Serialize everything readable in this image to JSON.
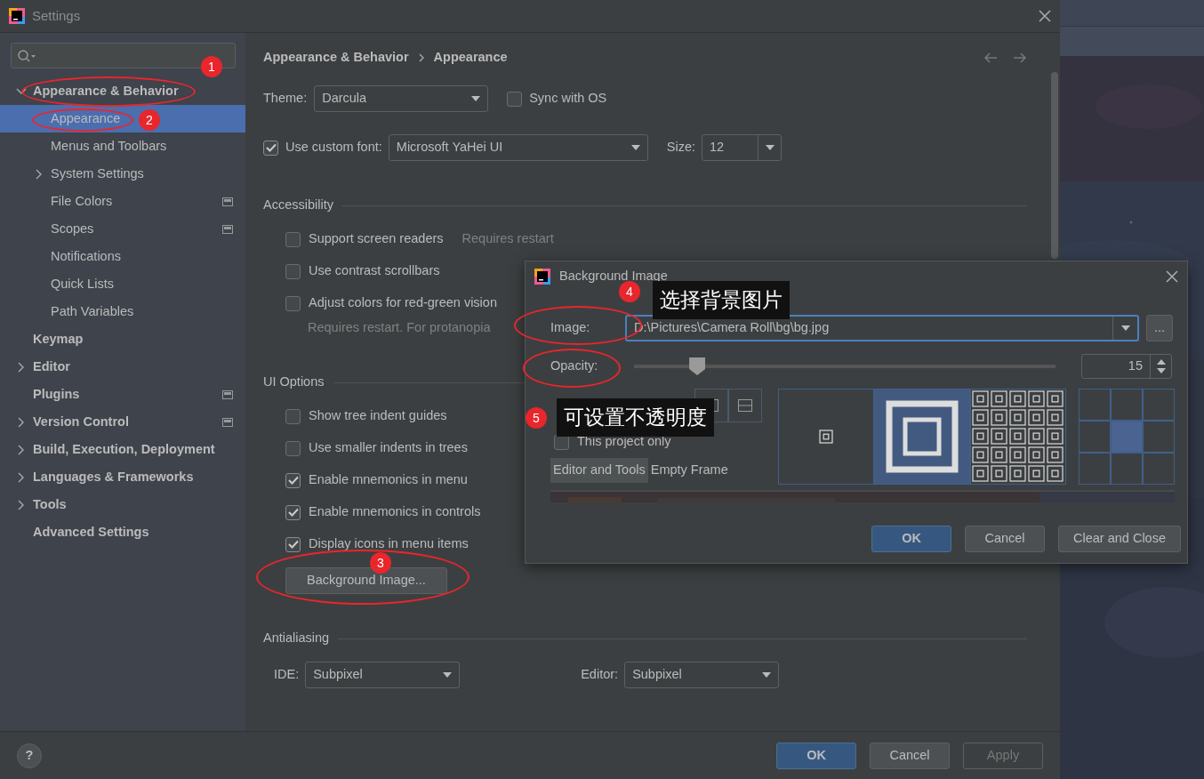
{
  "window": {
    "title": "Settings"
  },
  "sidebar": {
    "items": [
      {
        "label": "Appearance & Behavior",
        "expanded": true,
        "selected": false,
        "scope_icon": false,
        "children": [
          {
            "label": "Appearance",
            "selected": true,
            "scope_icon": false
          },
          {
            "label": "Menus and Toolbars",
            "selected": false,
            "scope_icon": false
          },
          {
            "label": "System Settings",
            "expanded": false,
            "selected": false,
            "scope_icon": false
          },
          {
            "label": "File Colors",
            "selected": false,
            "scope_icon": true
          },
          {
            "label": "Scopes",
            "selected": false,
            "scope_icon": true
          },
          {
            "label": "Notifications",
            "selected": false,
            "scope_icon": false
          },
          {
            "label": "Quick Lists",
            "selected": false,
            "scope_icon": false
          },
          {
            "label": "Path Variables",
            "selected": false,
            "scope_icon": false
          }
        ]
      },
      {
        "label": "Keymap",
        "selected": false,
        "scope_icon": false
      },
      {
        "label": "Editor",
        "expanded": false,
        "selected": false,
        "scope_icon": false
      },
      {
        "label": "Plugins",
        "selected": false,
        "scope_icon": true
      },
      {
        "label": "Version Control",
        "expanded": false,
        "selected": false,
        "scope_icon": true
      },
      {
        "label": "Build, Execution, Deployment",
        "expanded": false,
        "selected": false,
        "scope_icon": false
      },
      {
        "label": "Languages & Frameworks",
        "expanded": false,
        "selected": false,
        "scope_icon": false
      },
      {
        "label": "Tools",
        "expanded": false,
        "selected": false,
        "scope_icon": false
      },
      {
        "label": "Advanced Settings",
        "selected": false,
        "scope_icon": false
      }
    ]
  },
  "breadcrumb": [
    "Appearance & Behavior",
    "Appearance"
  ],
  "theme": {
    "label": "Theme:",
    "value": "Darcula",
    "sync": {
      "label": "Sync with OS",
      "checked": false
    }
  },
  "font": {
    "label": "Use custom font:",
    "checked": true,
    "value": "Microsoft YaHei UI",
    "size_label": "Size:",
    "size": "12"
  },
  "sections": [
    {
      "title": "Accessibility",
      "options": [
        {
          "label": "Support screen readers",
          "checked": false,
          "note": "Requires restart"
        },
        {
          "label": "Use contrast scrollbars",
          "checked": false
        },
        {
          "label": "Adjust colors for red-green vision",
          "checked": false,
          "hint": "Requires restart. For protanopia"
        }
      ]
    },
    {
      "title": "UI Options",
      "options": [
        {
          "label": "Show tree indent guides",
          "checked": false
        },
        {
          "label": "Use smaller indents in trees",
          "checked": false
        },
        {
          "label": "Enable mnemonics in menu",
          "checked": true
        },
        {
          "label": "Enable mnemonics in controls",
          "checked": true
        },
        {
          "label": "Display icons in menu items",
          "checked": true
        }
      ],
      "button": "Background Image..."
    },
    {
      "title": "Antialiasing",
      "fields": [
        {
          "label": "IDE:",
          "value": "Subpixel"
        },
        {
          "label": "Editor:",
          "value": "Subpixel"
        }
      ]
    }
  ],
  "footer": {
    "help": "?",
    "buttons": [
      {
        "label": "OK",
        "kind": "primary",
        "disabled": false
      },
      {
        "label": "Cancel",
        "kind": "normal",
        "disabled": false
      },
      {
        "label": "Apply",
        "kind": "normal",
        "disabled": true
      }
    ]
  },
  "dialog": {
    "title": "Background Image",
    "image_label": "Image:",
    "image_path": "D:\\Pictures\\Camera Roll\\bg\\bg.jpg",
    "browse": "...",
    "opacity_label": "Opacity:",
    "opacity": {
      "level": 0.15,
      "reading": "15"
    },
    "this_project": {
      "label": "This project only",
      "checked": false
    },
    "tabs": [
      {
        "label": "Editor and Tools",
        "selected": true
      },
      {
        "label": "Empty Frame",
        "selected": false
      }
    ],
    "fill_modes": [
      {
        "kind": "center",
        "selected": false
      },
      {
        "kind": "scale",
        "selected": true
      },
      {
        "kind": "tile",
        "selected": false
      }
    ],
    "anchors": [
      {
        "selected": false
      },
      {
        "selected": false
      },
      {
        "selected": false
      },
      {
        "selected": false
      },
      {
        "selected": true
      },
      {
        "selected": false
      },
      {
        "selected": false
      },
      {
        "selected": false
      },
      {
        "selected": false
      }
    ],
    "buttons": [
      {
        "label": "OK",
        "kind": "primary"
      },
      {
        "label": "Cancel",
        "kind": "normal"
      },
      {
        "label": "Clear and Close",
        "kind": "normal"
      }
    ]
  },
  "annotations": [
    {
      "number": "1"
    },
    {
      "number": "2"
    },
    {
      "number": "3"
    },
    {
      "number": "4",
      "callout": "选择背景图片"
    },
    {
      "number": "5",
      "callout": "可设置不透明度"
    }
  ]
}
